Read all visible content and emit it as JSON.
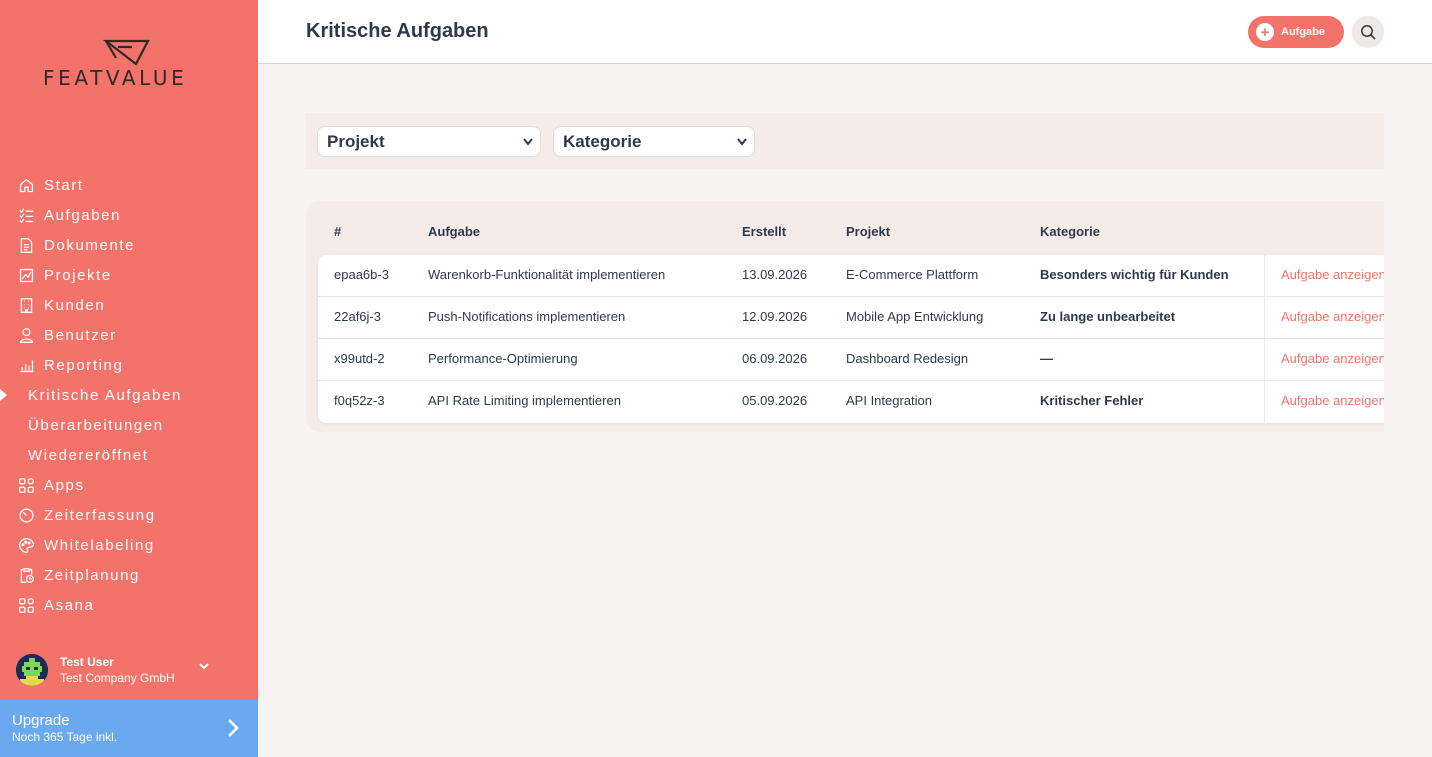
{
  "brand": {
    "name": "FEATVALUE",
    "accent": "#f3736b",
    "upgrade_color": "#6aa9ef"
  },
  "header": {
    "title": "Kritische Aufgaben",
    "add_label": "Aufgabe"
  },
  "nav": {
    "start": {
      "label": "Start",
      "icon": "home-icon"
    },
    "aufgaben": {
      "label": "Aufgaben",
      "icon": "checklist-icon"
    },
    "dokumente": {
      "label": "Dokumente",
      "icon": "document-icon"
    },
    "projekte": {
      "label": "Projekte",
      "icon": "chart-icon"
    },
    "kunden": {
      "label": "Kunden",
      "icon": "building-icon"
    },
    "benutzer": {
      "label": "Benutzer",
      "icon": "user-icon"
    },
    "reporting": {
      "label": "Reporting",
      "icon": "bar-chart-icon"
    },
    "kritisch": {
      "label": "Kritische Aufgaben",
      "active": true
    },
    "ueberarbeitungen": {
      "label": "Überarbeitungen"
    },
    "wiedereroeffnet": {
      "label": "Wiedereröffnet"
    },
    "apps": {
      "label": "Apps",
      "icon": "apps-icon"
    },
    "zeiterfassung": {
      "label": "Zeiterfassung",
      "icon": "timer-icon"
    },
    "whitelabeling": {
      "label": "Whitelabeling",
      "icon": "palette-icon"
    },
    "zeitplanung": {
      "label": "Zeitplanung",
      "icon": "clipboard-clock-icon"
    },
    "asana": {
      "label": "Asana",
      "icon": "apps-icon"
    }
  },
  "user": {
    "name": "Test User",
    "company": "Test Company GmbH"
  },
  "upgrade": {
    "title": "Upgrade",
    "subtitle": "Noch 365 Tage inkl."
  },
  "filters": {
    "projekt": "Projekt",
    "kategorie": "Kategorie"
  },
  "table": {
    "headers": {
      "id": "#",
      "aufgabe": "Aufgabe",
      "erstellt": "Erstellt",
      "projekt": "Projekt",
      "kategorie": "Kategorie"
    },
    "rows": [
      {
        "id": "epaa6b-3",
        "aufgabe": "Warenkorb-Funktionalität implementieren",
        "erstellt": "13.09.2026",
        "projekt": "E-Commerce Plattform",
        "kategorie": "Besonders wichtig für Kunden",
        "action": "Aufgabe anzeigen"
      },
      {
        "id": "22af6j-3",
        "aufgabe": "Push-Notifications implementieren",
        "erstellt": "12.09.2026",
        "projekt": "Mobile App Entwicklung",
        "kategorie": "Zu lange unbearbeitet",
        "action": "Aufgabe anzeigen"
      },
      {
        "id": "x99utd-2",
        "aufgabe": "Performance-Optimierung",
        "erstellt": "06.09.2026",
        "projekt": "Dashboard Redesign",
        "kategorie": "—",
        "action": "Aufgabe anzeigen"
      },
      {
        "id": "f0q52z-3",
        "aufgabe": "API Rate Limiting implementieren",
        "erstellt": "05.09.2026",
        "projekt": "API Integration",
        "kategorie": "Kritischer Fehler",
        "action": "Aufgabe anzeigen"
      }
    ]
  }
}
